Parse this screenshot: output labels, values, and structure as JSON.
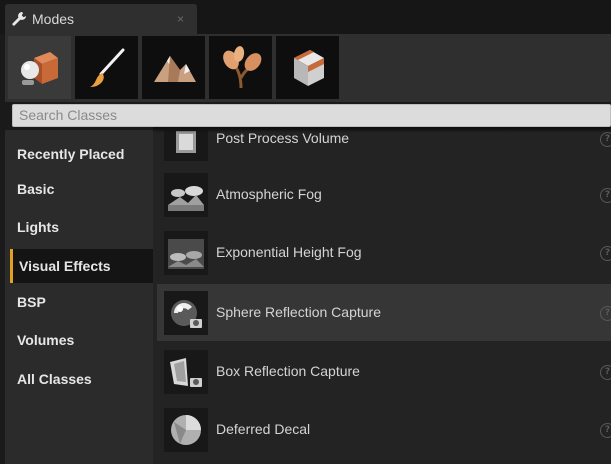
{
  "tab": {
    "title": "Modes",
    "close_glyph": "×",
    "icon": "wrench-icon"
  },
  "modes": [
    {
      "icon": "place-mode-icon",
      "active": true
    },
    {
      "icon": "paint-brush-icon",
      "active": false
    },
    {
      "icon": "landscape-mountain-icon",
      "active": false
    },
    {
      "icon": "foliage-leaves-icon",
      "active": false
    },
    {
      "icon": "mesh-paint-cube-icon",
      "active": false
    }
  ],
  "search": {
    "placeholder": "Search Classes"
  },
  "categories": [
    {
      "label": "Recently Placed",
      "active": false
    },
    {
      "label": "Basic",
      "active": false
    },
    {
      "label": "Lights",
      "active": false
    },
    {
      "label": "Visual Effects",
      "active": true
    },
    {
      "label": "BSP",
      "active": false
    },
    {
      "label": "Volumes",
      "active": false
    },
    {
      "label": "All Classes",
      "active": false
    }
  ],
  "items": [
    {
      "label": "Post Process Volume",
      "icon": "post-process-volume-icon"
    },
    {
      "label": "Atmospheric Fog",
      "icon": "atmospheric-fog-icon"
    },
    {
      "label": "Exponential Height Fog",
      "icon": "exponential-height-fog-icon"
    },
    {
      "label": "Sphere Reflection Capture",
      "icon": "sphere-reflection-capture-icon",
      "selected": true
    },
    {
      "label": "Box Reflection Capture",
      "icon": "box-reflection-capture-icon"
    },
    {
      "label": "Deferred Decal",
      "icon": "deferred-decal-icon"
    }
  ],
  "help_glyph": "?",
  "colors": {
    "accent": "#e0a020",
    "panel": "#2b2b2b",
    "list_bg": "#232323",
    "selected_row": "#363636"
  }
}
